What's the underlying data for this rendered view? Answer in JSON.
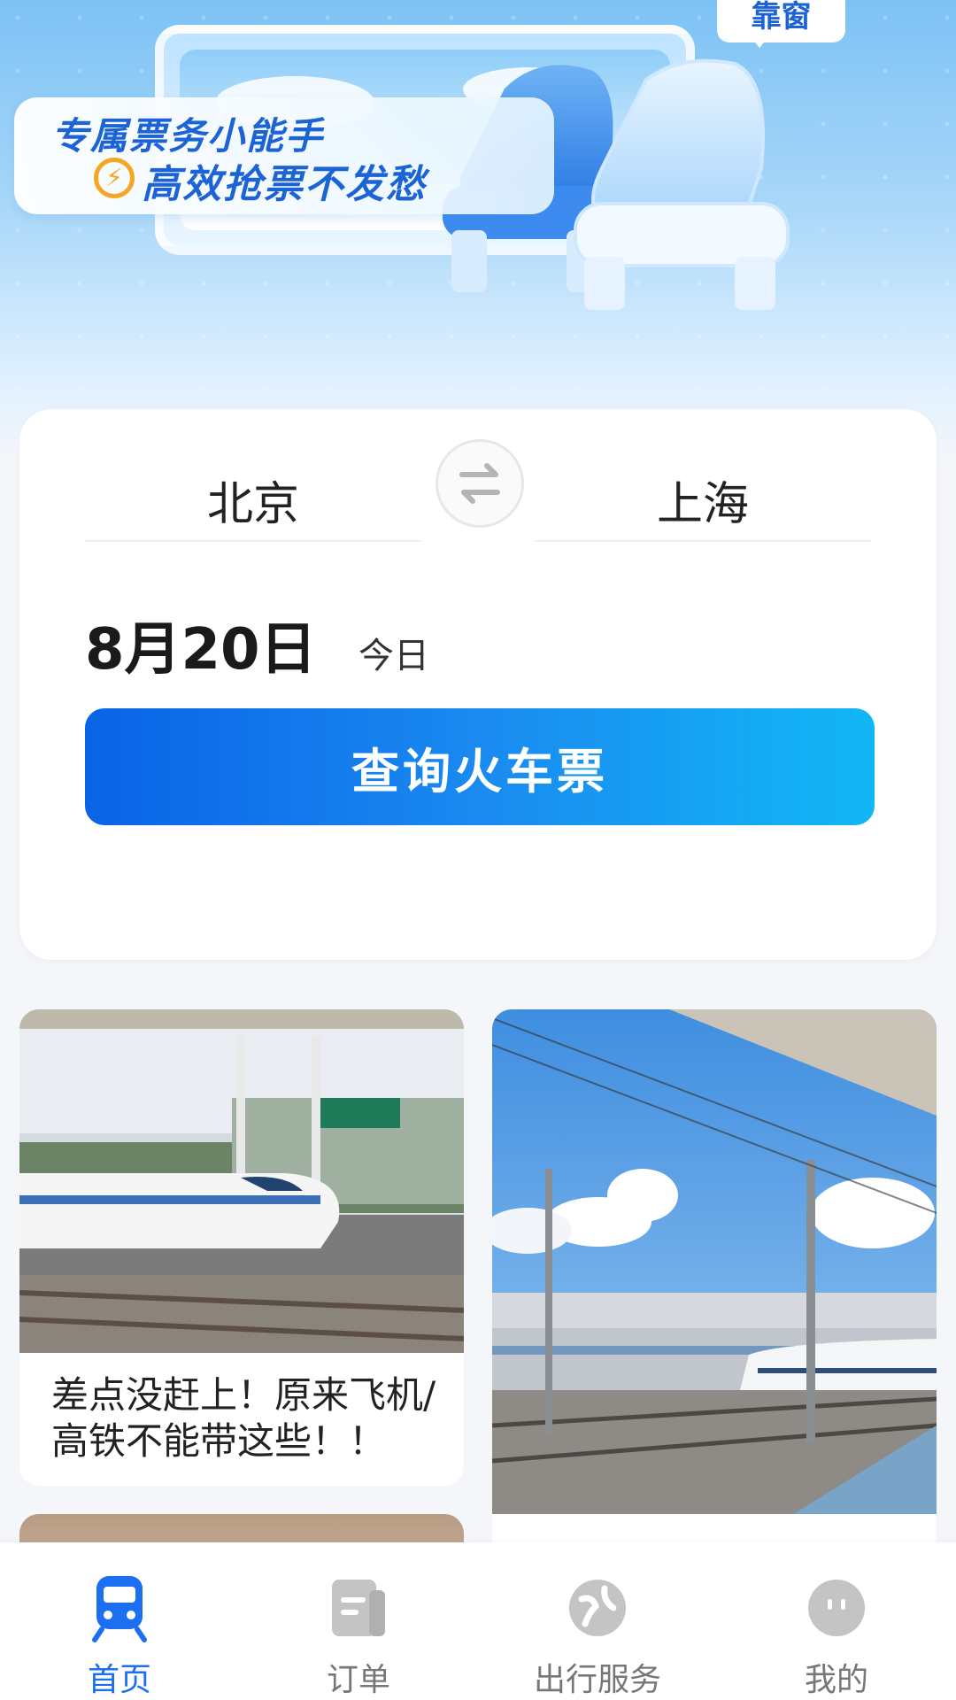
{
  "hero": {
    "tag": "靠窗",
    "banner_line1": "专属票务小能手",
    "banner_line2": "高效抢票不发愁"
  },
  "search": {
    "from_city": "北京",
    "to_city": "上海",
    "date": "8月20日",
    "date_note": "今日",
    "button_label": "查询火车票"
  },
  "feed": {
    "items": [
      {
        "title_line1": "差点没赶上！原来飞机/",
        "title_line2": "高铁不能带这些！！"
      },
      {
        "title_line1": "",
        "title_line2": ""
      }
    ]
  },
  "nav": {
    "items": [
      {
        "label": "首页",
        "icon": "train-icon"
      },
      {
        "label": "订单",
        "icon": "order-icon"
      },
      {
        "label": "出行服务",
        "icon": "travel-service-icon"
      },
      {
        "label": "我的",
        "icon": "profile-icon"
      }
    ],
    "active_color": "#1c6ff0",
    "inactive_color": "#bdbdbd"
  }
}
